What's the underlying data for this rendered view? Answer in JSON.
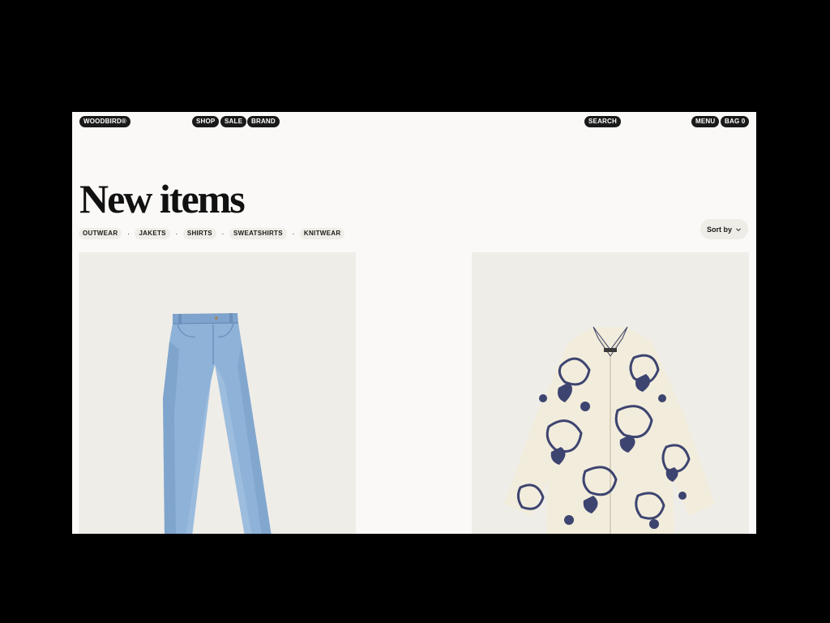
{
  "header": {
    "logo": "WOODBIRD®",
    "nav": [
      "SHOP",
      "SALE",
      "BRAND"
    ],
    "search_label": "SEARCH",
    "menu_label": "MENU",
    "bag_label": "BAG 0"
  },
  "page": {
    "title": "New items",
    "filters": [
      "OUTWEAR",
      "JAKETS",
      "SHIRTS",
      "SWEATSHIRTS",
      "KNITWEAR"
    ],
    "sort_label": "Sort by"
  },
  "products": [
    {
      "image": "blue-denim-jeans"
    },
    {
      "image": "paisley-print-shirt"
    }
  ],
  "colors": {
    "background": "#faf9f7",
    "pill": "#1a1a1a",
    "chip": "#efede7",
    "card": "#efede8"
  }
}
